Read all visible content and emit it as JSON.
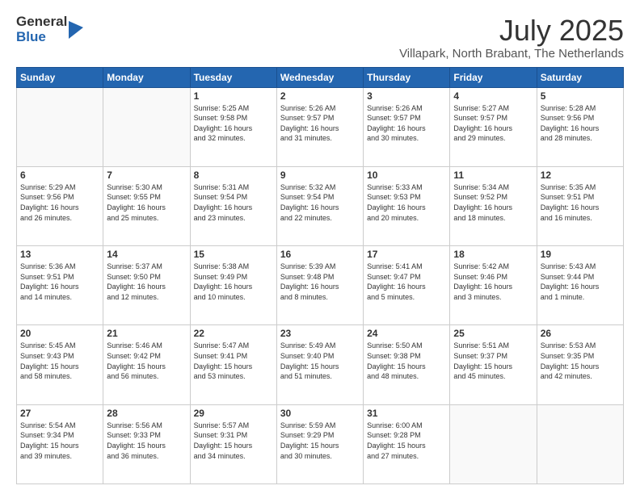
{
  "logo": {
    "general": "General",
    "blue": "Blue"
  },
  "title": {
    "month_year": "July 2025",
    "location": "Villapark, North Brabant, The Netherlands"
  },
  "weekdays": [
    "Sunday",
    "Monday",
    "Tuesday",
    "Wednesday",
    "Thursday",
    "Friday",
    "Saturday"
  ],
  "weeks": [
    [
      {
        "day": "",
        "lines": []
      },
      {
        "day": "",
        "lines": []
      },
      {
        "day": "1",
        "lines": [
          "Sunrise: 5:25 AM",
          "Sunset: 9:58 PM",
          "Daylight: 16 hours",
          "and 32 minutes."
        ]
      },
      {
        "day": "2",
        "lines": [
          "Sunrise: 5:26 AM",
          "Sunset: 9:57 PM",
          "Daylight: 16 hours",
          "and 31 minutes."
        ]
      },
      {
        "day": "3",
        "lines": [
          "Sunrise: 5:26 AM",
          "Sunset: 9:57 PM",
          "Daylight: 16 hours",
          "and 30 minutes."
        ]
      },
      {
        "day": "4",
        "lines": [
          "Sunrise: 5:27 AM",
          "Sunset: 9:57 PM",
          "Daylight: 16 hours",
          "and 29 minutes."
        ]
      },
      {
        "day": "5",
        "lines": [
          "Sunrise: 5:28 AM",
          "Sunset: 9:56 PM",
          "Daylight: 16 hours",
          "and 28 minutes."
        ]
      }
    ],
    [
      {
        "day": "6",
        "lines": [
          "Sunrise: 5:29 AM",
          "Sunset: 9:56 PM",
          "Daylight: 16 hours",
          "and 26 minutes."
        ]
      },
      {
        "day": "7",
        "lines": [
          "Sunrise: 5:30 AM",
          "Sunset: 9:55 PM",
          "Daylight: 16 hours",
          "and 25 minutes."
        ]
      },
      {
        "day": "8",
        "lines": [
          "Sunrise: 5:31 AM",
          "Sunset: 9:54 PM",
          "Daylight: 16 hours",
          "and 23 minutes."
        ]
      },
      {
        "day": "9",
        "lines": [
          "Sunrise: 5:32 AM",
          "Sunset: 9:54 PM",
          "Daylight: 16 hours",
          "and 22 minutes."
        ]
      },
      {
        "day": "10",
        "lines": [
          "Sunrise: 5:33 AM",
          "Sunset: 9:53 PM",
          "Daylight: 16 hours",
          "and 20 minutes."
        ]
      },
      {
        "day": "11",
        "lines": [
          "Sunrise: 5:34 AM",
          "Sunset: 9:52 PM",
          "Daylight: 16 hours",
          "and 18 minutes."
        ]
      },
      {
        "day": "12",
        "lines": [
          "Sunrise: 5:35 AM",
          "Sunset: 9:51 PM",
          "Daylight: 16 hours",
          "and 16 minutes."
        ]
      }
    ],
    [
      {
        "day": "13",
        "lines": [
          "Sunrise: 5:36 AM",
          "Sunset: 9:51 PM",
          "Daylight: 16 hours",
          "and 14 minutes."
        ]
      },
      {
        "day": "14",
        "lines": [
          "Sunrise: 5:37 AM",
          "Sunset: 9:50 PM",
          "Daylight: 16 hours",
          "and 12 minutes."
        ]
      },
      {
        "day": "15",
        "lines": [
          "Sunrise: 5:38 AM",
          "Sunset: 9:49 PM",
          "Daylight: 16 hours",
          "and 10 minutes."
        ]
      },
      {
        "day": "16",
        "lines": [
          "Sunrise: 5:39 AM",
          "Sunset: 9:48 PM",
          "Daylight: 16 hours",
          "and 8 minutes."
        ]
      },
      {
        "day": "17",
        "lines": [
          "Sunrise: 5:41 AM",
          "Sunset: 9:47 PM",
          "Daylight: 16 hours",
          "and 5 minutes."
        ]
      },
      {
        "day": "18",
        "lines": [
          "Sunrise: 5:42 AM",
          "Sunset: 9:46 PM",
          "Daylight: 16 hours",
          "and 3 minutes."
        ]
      },
      {
        "day": "19",
        "lines": [
          "Sunrise: 5:43 AM",
          "Sunset: 9:44 PM",
          "Daylight: 16 hours",
          "and 1 minute."
        ]
      }
    ],
    [
      {
        "day": "20",
        "lines": [
          "Sunrise: 5:45 AM",
          "Sunset: 9:43 PM",
          "Daylight: 15 hours",
          "and 58 minutes."
        ]
      },
      {
        "day": "21",
        "lines": [
          "Sunrise: 5:46 AM",
          "Sunset: 9:42 PM",
          "Daylight: 15 hours",
          "and 56 minutes."
        ]
      },
      {
        "day": "22",
        "lines": [
          "Sunrise: 5:47 AM",
          "Sunset: 9:41 PM",
          "Daylight: 15 hours",
          "and 53 minutes."
        ]
      },
      {
        "day": "23",
        "lines": [
          "Sunrise: 5:49 AM",
          "Sunset: 9:40 PM",
          "Daylight: 15 hours",
          "and 51 minutes."
        ]
      },
      {
        "day": "24",
        "lines": [
          "Sunrise: 5:50 AM",
          "Sunset: 9:38 PM",
          "Daylight: 15 hours",
          "and 48 minutes."
        ]
      },
      {
        "day": "25",
        "lines": [
          "Sunrise: 5:51 AM",
          "Sunset: 9:37 PM",
          "Daylight: 15 hours",
          "and 45 minutes."
        ]
      },
      {
        "day": "26",
        "lines": [
          "Sunrise: 5:53 AM",
          "Sunset: 9:35 PM",
          "Daylight: 15 hours",
          "and 42 minutes."
        ]
      }
    ],
    [
      {
        "day": "27",
        "lines": [
          "Sunrise: 5:54 AM",
          "Sunset: 9:34 PM",
          "Daylight: 15 hours",
          "and 39 minutes."
        ]
      },
      {
        "day": "28",
        "lines": [
          "Sunrise: 5:56 AM",
          "Sunset: 9:33 PM",
          "Daylight: 15 hours",
          "and 36 minutes."
        ]
      },
      {
        "day": "29",
        "lines": [
          "Sunrise: 5:57 AM",
          "Sunset: 9:31 PM",
          "Daylight: 15 hours",
          "and 34 minutes."
        ]
      },
      {
        "day": "30",
        "lines": [
          "Sunrise: 5:59 AM",
          "Sunset: 9:29 PM",
          "Daylight: 15 hours",
          "and 30 minutes."
        ]
      },
      {
        "day": "31",
        "lines": [
          "Sunrise: 6:00 AM",
          "Sunset: 9:28 PM",
          "Daylight: 15 hours",
          "and 27 minutes."
        ]
      },
      {
        "day": "",
        "lines": []
      },
      {
        "day": "",
        "lines": []
      }
    ]
  ]
}
